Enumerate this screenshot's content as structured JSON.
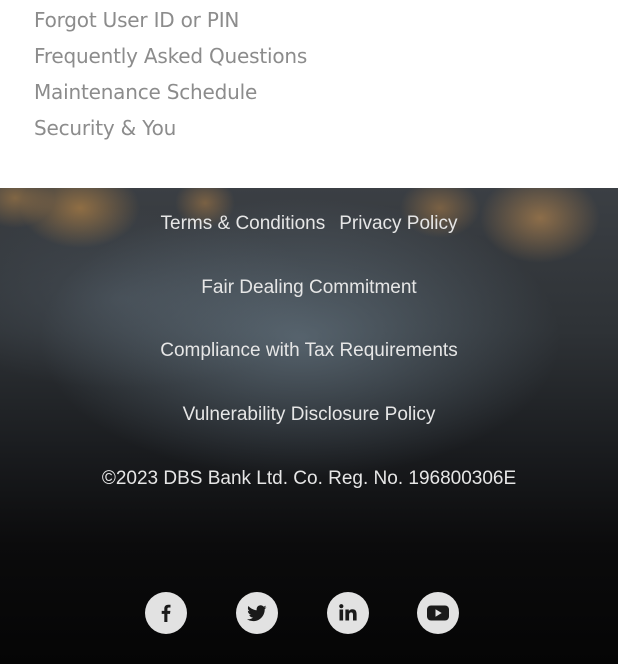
{
  "help_links": [
    {
      "label": "Forgot User ID or PIN"
    },
    {
      "label": "Frequently Asked Questions"
    },
    {
      "label": "Maintenance Schedule"
    },
    {
      "label": "Security & You"
    }
  ],
  "footer": {
    "terms_label": "Terms & Conditions",
    "privacy_label": "Privacy Policy",
    "fair_dealing_label": "Fair Dealing Commitment",
    "tax_label": "Compliance with Tax Requirements",
    "vulnerability_label": "Vulnerability Disclosure Policy",
    "copyright": "©2023 DBS Bank Ltd. Co. Reg. No. 196800306E"
  },
  "social": {
    "icons": [
      "facebook-icon",
      "twitter-icon",
      "linkedin-icon",
      "youtube-icon"
    ]
  },
  "colors": {
    "help_link_text": "#8c8c8c",
    "footer_text": "#e6e6e6",
    "social_icon_bg": "#e2e2e2",
    "social_icon_fg": "#1a1a1a"
  }
}
